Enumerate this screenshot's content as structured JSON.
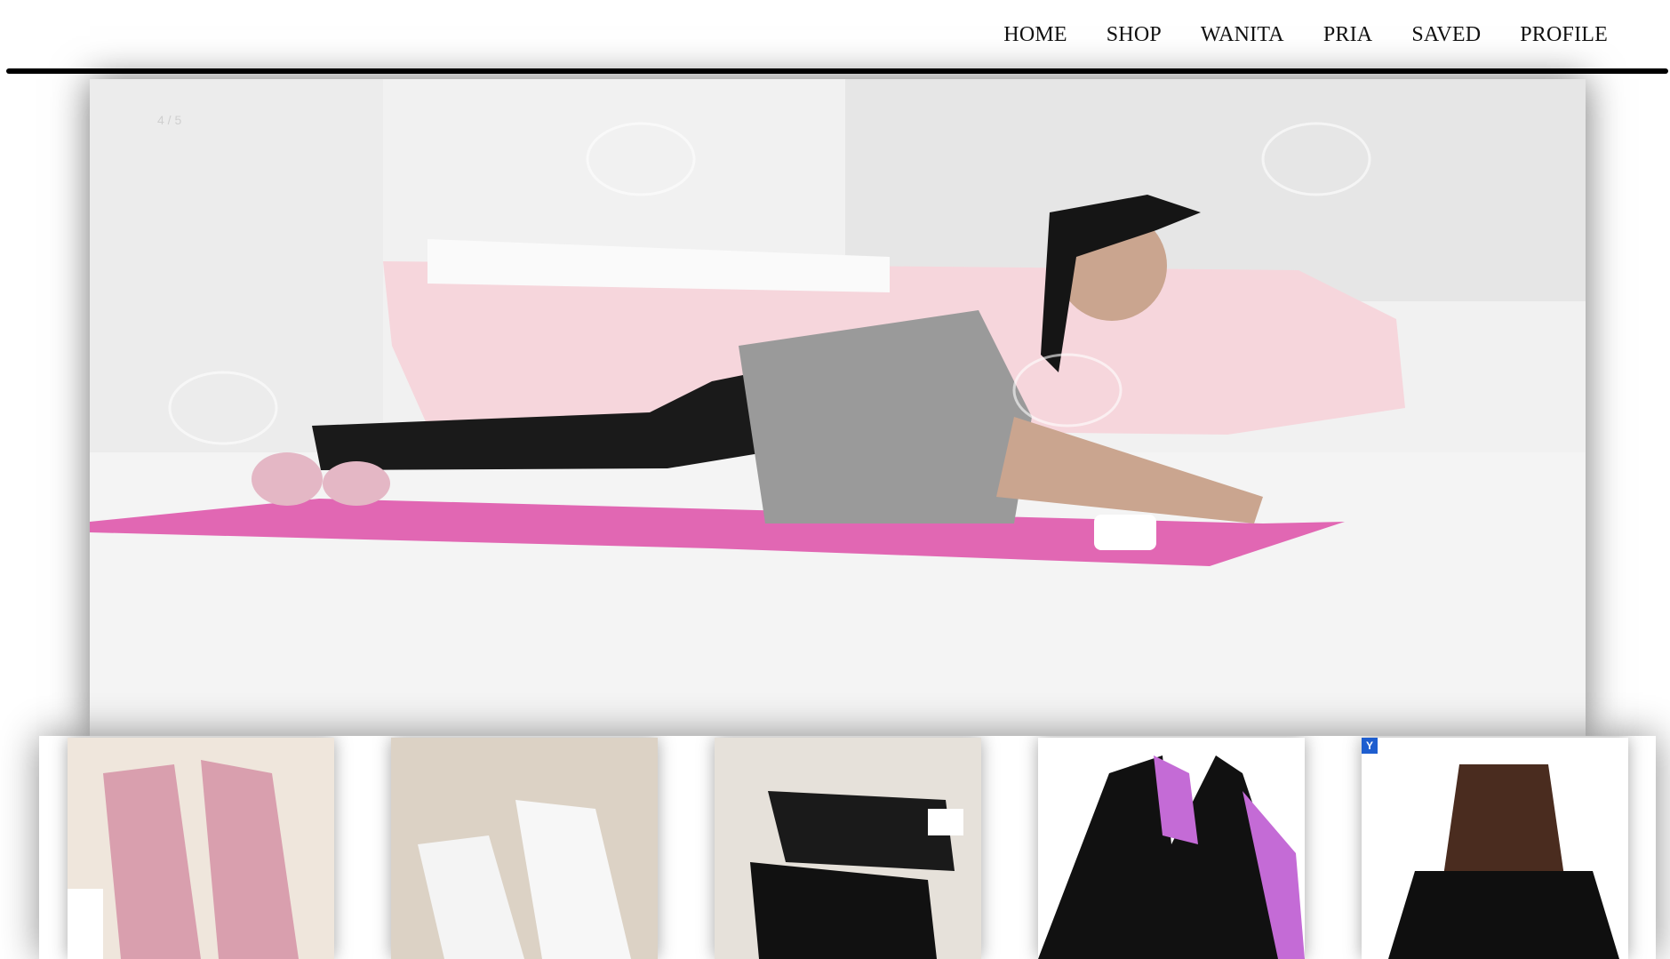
{
  "nav": {
    "items": [
      {
        "label": "HOME"
      },
      {
        "label": "SHOP"
      },
      {
        "label": "WANITA"
      },
      {
        "label": "PRIA"
      },
      {
        "label": "SAVED"
      },
      {
        "label": "PROFILE"
      }
    ]
  },
  "hero": {
    "slide_counter": "4 / 5",
    "image": "woman-plank-on-pink-mat-photo"
  },
  "cards": [
    {
      "image": "pink-sneakers-photo",
      "color": "#d9c0c0"
    },
    {
      "image": "white-sneakers-photo",
      "color": "#d6ccc0"
    },
    {
      "image": "black-sneakers-photo",
      "color": "#e2ddd6"
    },
    {
      "image": "black-sports-bra-photo",
      "color": "#ffffff"
    },
    {
      "image": "woman-black-top-photo",
      "color": "#ffffff",
      "badge": "Y"
    }
  ],
  "colors": {
    "header_rule": "#000000",
    "mat_pink": "#e167b3",
    "badge_blue": "#1e5ecf"
  }
}
